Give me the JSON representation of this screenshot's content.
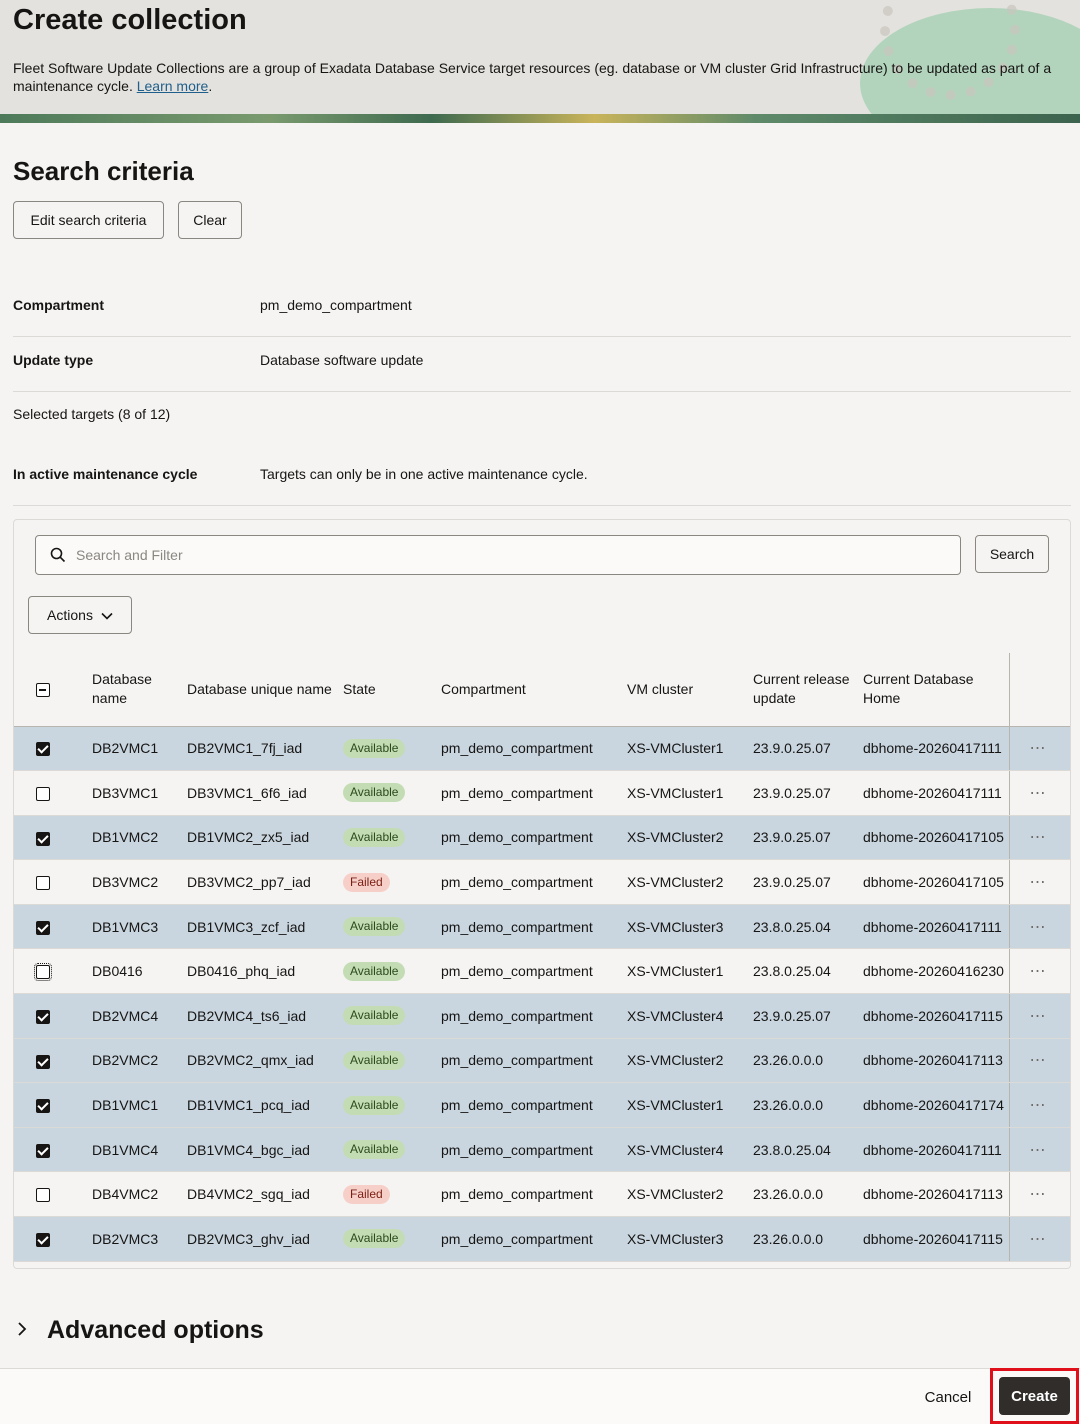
{
  "header": {
    "title": "Create collection",
    "description": "Fleet Software Update Collections are a group of Exadata Database Service target resources (eg. database or VM cluster Grid Infrastructure) to be updated as part of a maintenance cycle.",
    "learn_more": "Learn more",
    "period": "."
  },
  "search_criteria": {
    "title": "Search criteria",
    "edit_label": "Edit search criteria",
    "clear_label": "Clear"
  },
  "details": {
    "compartment_label": "Compartment",
    "compartment_value": "pm_demo_compartment",
    "update_type_label": "Update type",
    "update_type_value": "Database software update",
    "selected_targets": "Selected targets (8 of 12)",
    "active_cycle_label": "In active maintenance cycle",
    "active_cycle_value": "Targets can only be in one active maintenance cycle."
  },
  "toolbar": {
    "search_placeholder": "Search and Filter",
    "search_label": "Search",
    "actions_label": "Actions"
  },
  "table": {
    "headers": {
      "name": "Database name",
      "unique_name": "Database unique name",
      "state": "State",
      "compartment": "Compartment",
      "vm_cluster": "VM cluster",
      "release": "Current release update",
      "home": "Current Database Home"
    },
    "rows": [
      {
        "checked": true,
        "name": "DB2VMC1",
        "unique": "DB2VMC1_7fj_iad",
        "state": "Available",
        "comp": "pm_demo_compartment",
        "vm": "XS-VMCluster1",
        "rel": "23.9.0.25.07",
        "home": "dbhome-20260417111"
      },
      {
        "checked": false,
        "name": "DB3VMC1",
        "unique": "DB3VMC1_6f6_iad",
        "state": "Available",
        "comp": "pm_demo_compartment",
        "vm": "XS-VMCluster1",
        "rel": "23.9.0.25.07",
        "home": "dbhome-20260417111"
      },
      {
        "checked": true,
        "name": "DB1VMC2",
        "unique": "DB1VMC2_zx5_iad",
        "state": "Available",
        "comp": "pm_demo_compartment",
        "vm": "XS-VMCluster2",
        "rel": "23.9.0.25.07",
        "home": "dbhome-20260417105"
      },
      {
        "checked": false,
        "name": "DB3VMC2",
        "unique": "DB3VMC2_pp7_iad",
        "state": "Failed",
        "comp": "pm_demo_compartment",
        "vm": "XS-VMCluster2",
        "rel": "23.9.0.25.07",
        "home": "dbhome-20260417105"
      },
      {
        "checked": true,
        "name": "DB1VMC3",
        "unique": "DB1VMC3_zcf_iad",
        "state": "Available",
        "comp": "pm_demo_compartment",
        "vm": "XS-VMCluster3",
        "rel": "23.8.0.25.04",
        "home": "dbhome-20260417111"
      },
      {
        "checked": false,
        "name": "DB0416",
        "unique": "DB0416_phq_iad",
        "state": "Available",
        "comp": "pm_demo_compartment",
        "vm": "XS-VMCluster1",
        "rel": "23.8.0.25.04",
        "home": "dbhome-20260416230"
      },
      {
        "checked": true,
        "name": "DB2VMC4",
        "unique": "DB2VMC4_ts6_iad",
        "state": "Available",
        "comp": "pm_demo_compartment",
        "vm": "XS-VMCluster4",
        "rel": "23.9.0.25.07",
        "home": "dbhome-20260417115"
      },
      {
        "checked": true,
        "name": "DB2VMC2",
        "unique": "DB2VMC2_qmx_iad",
        "state": "Available",
        "comp": "pm_demo_compartment",
        "vm": "XS-VMCluster2",
        "rel": "23.26.0.0.0",
        "home": "dbhome-20260417113"
      },
      {
        "checked": true,
        "name": "DB1VMC1",
        "unique": "DB1VMC1_pcq_iad",
        "state": "Available",
        "comp": "pm_demo_compartment",
        "vm": "XS-VMCluster1",
        "rel": "23.26.0.0.0",
        "home": "dbhome-20260417174"
      },
      {
        "checked": true,
        "name": "DB1VMC4",
        "unique": "DB1VMC4_bgc_iad",
        "state": "Available",
        "comp": "pm_demo_compartment",
        "vm": "XS-VMCluster4",
        "rel": "23.8.0.25.04",
        "home": "dbhome-20260417111"
      },
      {
        "checked": false,
        "name": "DB4VMC2",
        "unique": "DB4VMC2_sgq_iad",
        "state": "Failed",
        "comp": "pm_demo_compartment",
        "vm": "XS-VMCluster2",
        "rel": "23.26.0.0.0",
        "home": "dbhome-20260417113"
      },
      {
        "checked": true,
        "name": "DB2VMC3",
        "unique": "DB2VMC3_ghv_iad",
        "state": "Available",
        "comp": "pm_demo_compartment",
        "vm": "XS-VMCluster3",
        "rel": "23.26.0.0.0",
        "home": "dbhome-20260417115"
      }
    ]
  },
  "advanced": {
    "title": "Advanced options"
  },
  "footer": {
    "cancel_label": "Cancel",
    "create_label": "Create"
  },
  "icons": {
    "more": "more-horizontal-icon",
    "search": "search-icon",
    "chevron": "chevron-down-icon"
  },
  "colors": {
    "selected_row": "#c9d6e0",
    "available_badge": "#c4dcb4",
    "failed_badge": "#f7cfc9",
    "create_button": "#312d2a",
    "highlight": "#e0101a"
  }
}
